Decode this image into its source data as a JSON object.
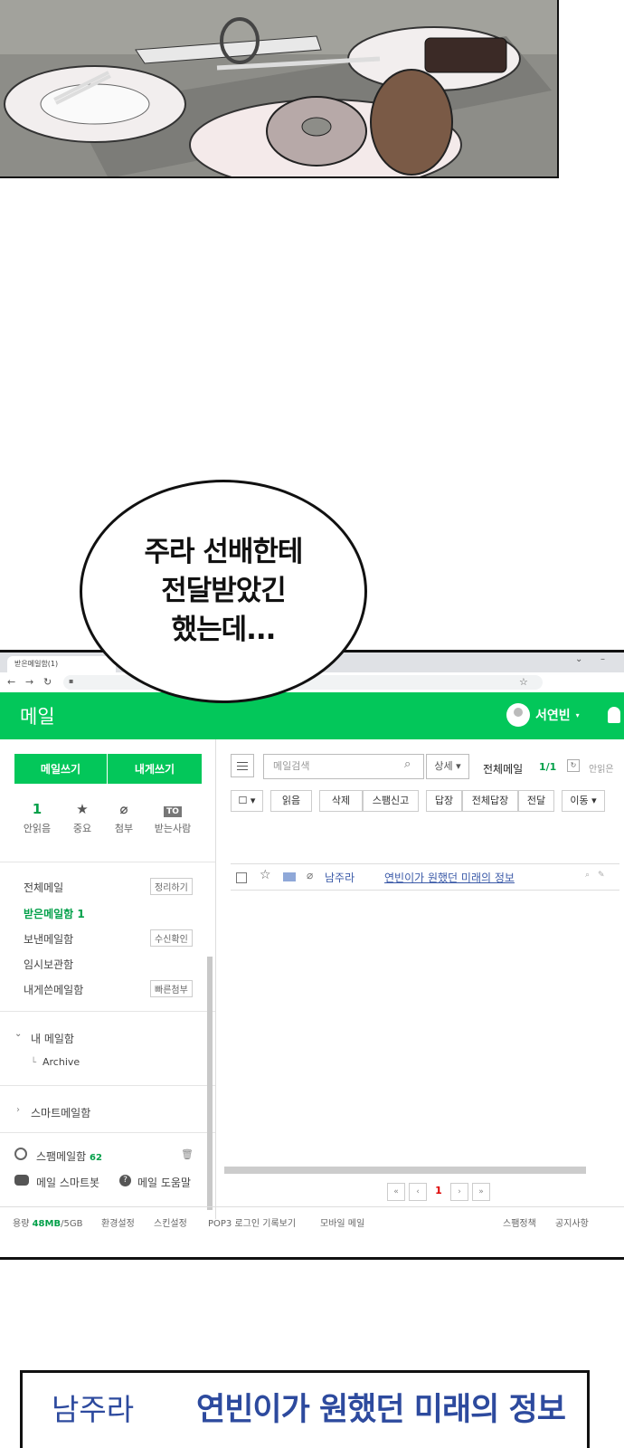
{
  "bubble": {
    "text": "주라 선배한테\n전달받았긴\n했는데..."
  },
  "browser": {
    "tab_title": "받은메일함(1)"
  },
  "app": {
    "title": "메일",
    "user_name": "서연빈"
  },
  "sidebar": {
    "compose_label": "메일쓰기",
    "self_label": "내게쓰기",
    "quick": [
      {
        "icon": "1",
        "label": "안읽음"
      },
      {
        "icon": "★",
        "label": "중요"
      },
      {
        "icon": "⌀",
        "label": "첨부"
      },
      {
        "icon": "TO",
        "label": "받는사람"
      }
    ],
    "folders": [
      {
        "label": "전체메일",
        "tag": "정리하기"
      },
      {
        "label": "받은메일함 1",
        "tag": ""
      },
      {
        "label": "보낸메일함",
        "tag": "수신확인"
      },
      {
        "label": "임시보관함",
        "tag": ""
      },
      {
        "label": "내게쓴메일함",
        "tag": "빠른첨부"
      }
    ],
    "my_mailbox": "내 메일함",
    "archive": "Archive",
    "smart_mailbox": "스마트메일함",
    "spam": "스팸메일함",
    "spam_count": "62",
    "smartbot": "메일 스마트봇",
    "help": "메일 도움말"
  },
  "toolbar": {
    "search_placeholder": "메일검색",
    "detail_label": "상세",
    "all_mail": "전체메일",
    "count": "1/1",
    "unread_label": "안읽은",
    "buttons": [
      "읽음",
      "삭제",
      "스팸신고",
      "답장",
      "전체답장",
      "전달",
      "이동"
    ]
  },
  "messages": [
    {
      "sender": "남주라",
      "subject": "연빈이가 원했던 미래의 정보"
    }
  ],
  "pager": {
    "current": "1"
  },
  "footer": {
    "usage_prefix": "용량",
    "usage_value": "48MB",
    "usage_total": "/5GB",
    "links": [
      "환경설정",
      "스킨설정",
      "POP3 로그인 기록보기",
      "모바일 메일"
    ],
    "right_links": [
      "스팸정책",
      "공지사항"
    ]
  },
  "zoom_panel": {
    "sender": "남주라",
    "subject": "연빈이가 원했던 미래의 정보"
  }
}
